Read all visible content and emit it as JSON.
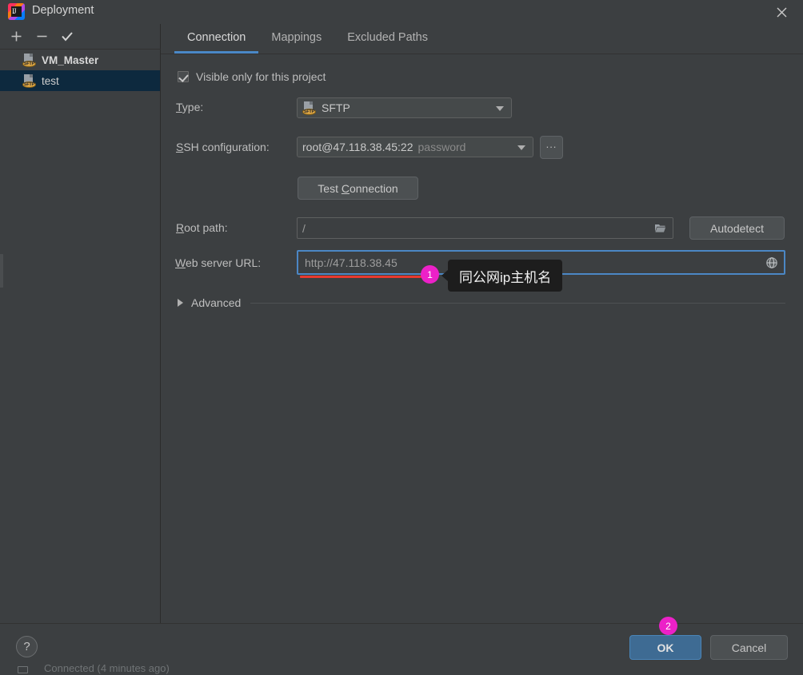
{
  "window": {
    "title": "Deployment",
    "logo_icon": "intellij-idea-logo",
    "close_icon": "close-icon"
  },
  "sidebar": {
    "toolbar": [
      {
        "name": "add",
        "icon": "plus-icon"
      },
      {
        "name": "remove",
        "icon": "minus-icon"
      },
      {
        "name": "set-default",
        "icon": "check-icon"
      }
    ],
    "servers": [
      {
        "label": "VM_Master",
        "icon": "sftp-icon",
        "badge": "SFTP",
        "selected": false,
        "bold": true
      },
      {
        "label": "test",
        "icon": "sftp-icon",
        "badge": "SFTP",
        "selected": true,
        "bold": false
      }
    ]
  },
  "tabs": [
    {
      "label": "Connection",
      "active": true
    },
    {
      "label": "Mappings",
      "active": false
    },
    {
      "label": "Excluded Paths",
      "active": false
    }
  ],
  "form": {
    "visible_only_checkbox": {
      "label": "Visible only for this project",
      "checked": true
    },
    "type": {
      "label": "Type:",
      "mnemonic": "T",
      "value": "SFTP",
      "icon": "sftp-icon",
      "badge": "SFTP"
    },
    "ssh_configuration": {
      "label": "SSH configuration:",
      "mnemonic": "S",
      "value": "root@47.118.38.45:22",
      "value_suffix": "password",
      "browse_button": "..."
    },
    "test_connection_button": {
      "label_before": "Test ",
      "mnemonic": "C",
      "label_after": "onnection"
    },
    "root_path": {
      "label": "Root path:",
      "mnemonic": "R",
      "value": "/",
      "browse_icon": "folder-icon",
      "autodetect_button": "Autodetect"
    },
    "web_server_url": {
      "label": "Web server URL:",
      "mnemonic": "W",
      "value": "http://47.118.38.45",
      "open_icon": "globe-icon",
      "focused": true
    },
    "advanced": {
      "label": "Advanced",
      "expanded": false,
      "icon": "chevron-right-icon"
    }
  },
  "footer": {
    "help_button": "?",
    "ok_button": "OK",
    "cancel_button": "Cancel"
  },
  "status_bar": {
    "text": "Connected (4 minutes ago)"
  },
  "annotations": [
    {
      "id": "1",
      "number": "1",
      "tooltip": "同公网ip主机名",
      "underline_color": "#e8392e"
    },
    {
      "id": "2",
      "number": "2",
      "tooltip": "",
      "underline_color": ""
    }
  ],
  "colors": {
    "accent": "#4a88c7",
    "annotation": "#ec21c8",
    "underline": "#e8392e",
    "ok_button": "#3e6b93",
    "selection": "#0d293e"
  }
}
